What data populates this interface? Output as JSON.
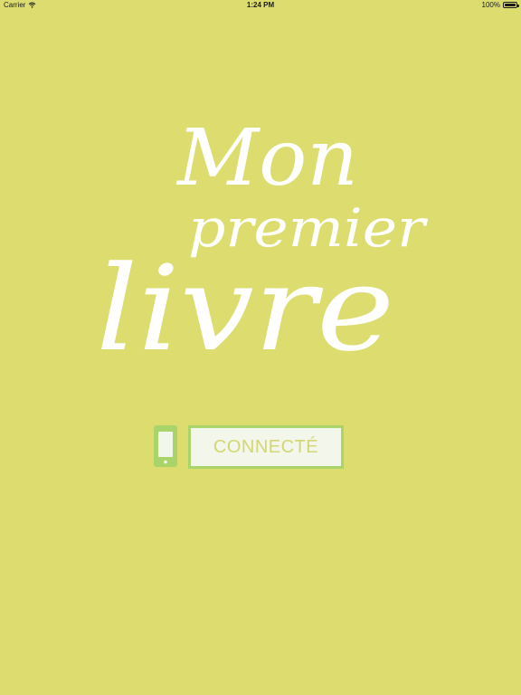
{
  "status_bar": {
    "carrier": "Carrier",
    "time": "1:24 PM",
    "battery_percent": "100%",
    "battery_level": 1.0,
    "wifi_icon": "wifi-icon",
    "battery_icon": "battery-icon"
  },
  "logo": {
    "line1": "Mon",
    "line2": "premier",
    "line3": "livre"
  },
  "connect": {
    "label": "CONNECTÉ",
    "icon": "smartphone-icon"
  },
  "colors": {
    "background": "#dcdd6e",
    "logo_text": "#ffffff",
    "button_border": "#a9d46a",
    "button_fill": "#f3f6ea",
    "button_text": "#d3d672",
    "device_icon": "#a9d46a"
  }
}
